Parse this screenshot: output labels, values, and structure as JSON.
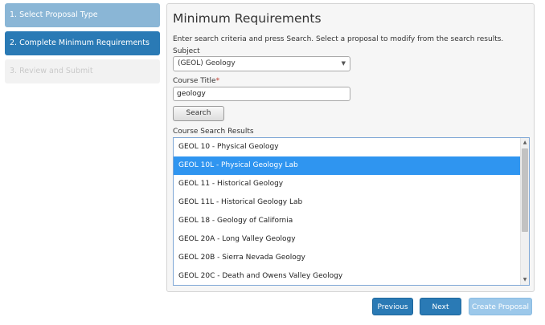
{
  "wizard": {
    "steps": [
      {
        "label": "1. Select Proposal Type",
        "state": "done"
      },
      {
        "label": "2. Complete Minimum Requirements",
        "state": "active"
      },
      {
        "label": "3. Review and Submit",
        "state": "pending"
      }
    ]
  },
  "main": {
    "title": "Minimum Requirements",
    "instructions": "Enter search criteria and press Search. Select a proposal to modify from the search results.",
    "subject": {
      "label": "Subject",
      "value": "(GEOL) Geology"
    },
    "course_title": {
      "label": "Course Title",
      "required_marker": "*",
      "value": "geology"
    },
    "search_button": "Search",
    "results": {
      "label": "Course Search Results",
      "selected_index": 1,
      "items": [
        "GEOL 10 - Physical Geology",
        "GEOL 10L - Physical Geology Lab",
        "GEOL 11 - Historical Geology",
        "GEOL 11L - Historical Geology Lab",
        "GEOL 18 - Geology of California",
        "GEOL 20A - Long Valley Geology",
        "GEOL 20B - Sierra Nevada Geology",
        "GEOL 20C - Death and Owens Valley Geology"
      ]
    }
  },
  "footer": {
    "previous": "Previous",
    "next": "Next",
    "create_proposal": "Create Proposal"
  },
  "colors": {
    "step_done": "#8ab6d6",
    "step_active": "#2a7ab5",
    "selection": "#2f95f0",
    "primary_button": "#2a7ab5",
    "disabled_button": "#9cc8ea"
  },
  "icons": {
    "select_arrow": "chevron-down-icon",
    "scroll_up": "scroll-up-arrow-icon",
    "scroll_down": "scroll-down-arrow-icon"
  }
}
